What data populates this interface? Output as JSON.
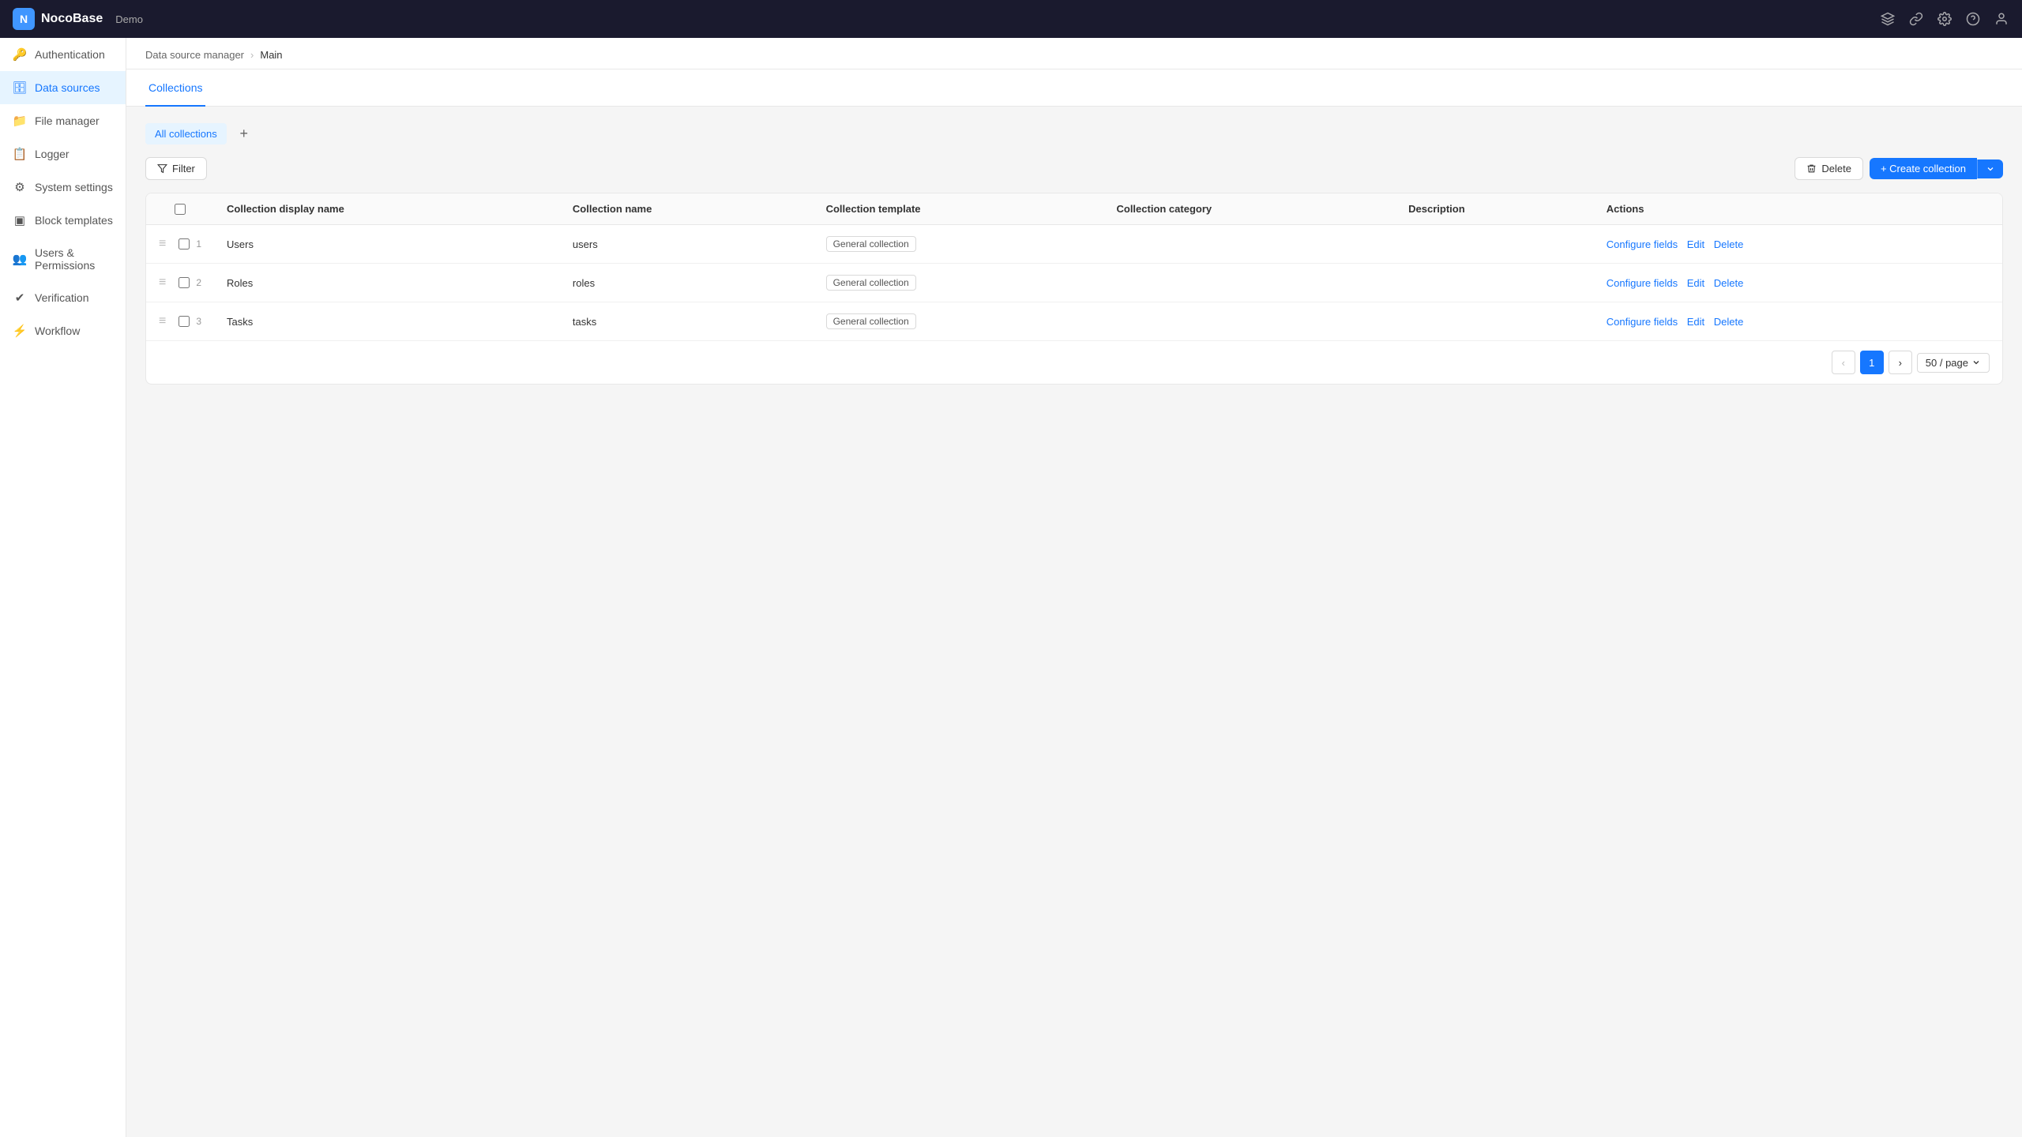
{
  "app": {
    "name": "NocoBase",
    "demo_label": "Demo"
  },
  "topbar": {
    "icons": [
      "plugin-icon",
      "link-icon",
      "settings-icon",
      "help-icon",
      "user-icon"
    ]
  },
  "sidebar": {
    "items": [
      {
        "id": "authentication",
        "label": "Authentication",
        "icon": "🔑"
      },
      {
        "id": "data-sources",
        "label": "Data sources",
        "icon": "🗄",
        "active": true
      },
      {
        "id": "file-manager",
        "label": "File manager",
        "icon": "📁"
      },
      {
        "id": "logger",
        "label": "Logger",
        "icon": "📋"
      },
      {
        "id": "system-settings",
        "label": "System settings",
        "icon": "⚙"
      },
      {
        "id": "block-templates",
        "label": "Block templates",
        "icon": "▣"
      },
      {
        "id": "users-permissions",
        "label": "Users & Permissions",
        "icon": "👥"
      },
      {
        "id": "verification",
        "label": "Verification",
        "icon": "✔"
      },
      {
        "id": "workflow",
        "label": "Workflow",
        "icon": "⚡"
      }
    ]
  },
  "breadcrumb": {
    "items": [
      {
        "label": "Data source manager",
        "link": true
      },
      {
        "label": "Main",
        "link": false
      }
    ]
  },
  "tabs": [
    {
      "id": "collections",
      "label": "Collections",
      "active": true
    }
  ],
  "subtabs": [
    {
      "id": "all-collections",
      "label": "All collections",
      "active": true
    }
  ],
  "toolbar": {
    "filter_label": "Filter",
    "delete_label": "Delete",
    "create_collection_label": "+ Create collection"
  },
  "table": {
    "columns": [
      {
        "id": "checkbox",
        "label": ""
      },
      {
        "id": "display-name",
        "label": "Collection display name"
      },
      {
        "id": "name",
        "label": "Collection name"
      },
      {
        "id": "template",
        "label": "Collection template"
      },
      {
        "id": "category",
        "label": "Collection category"
      },
      {
        "id": "description",
        "label": "Description"
      },
      {
        "id": "actions",
        "label": "Actions"
      }
    ],
    "rows": [
      {
        "num": 1,
        "display_name": "Users",
        "name": "users",
        "template": "General collection",
        "category": "",
        "description": "",
        "actions": [
          "Configure fields",
          "Edit",
          "Delete"
        ]
      },
      {
        "num": 2,
        "display_name": "Roles",
        "name": "roles",
        "template": "General collection",
        "category": "",
        "description": "",
        "actions": [
          "Configure fields",
          "Edit",
          "Delete"
        ]
      },
      {
        "num": 3,
        "display_name": "Tasks",
        "name": "tasks",
        "template": "General collection",
        "category": "",
        "description": "",
        "actions": [
          "Configure fields",
          "Edit",
          "Delete"
        ]
      }
    ]
  },
  "pagination": {
    "current_page": 1,
    "page_size": "50 / page",
    "page_size_label": "50 / page"
  }
}
